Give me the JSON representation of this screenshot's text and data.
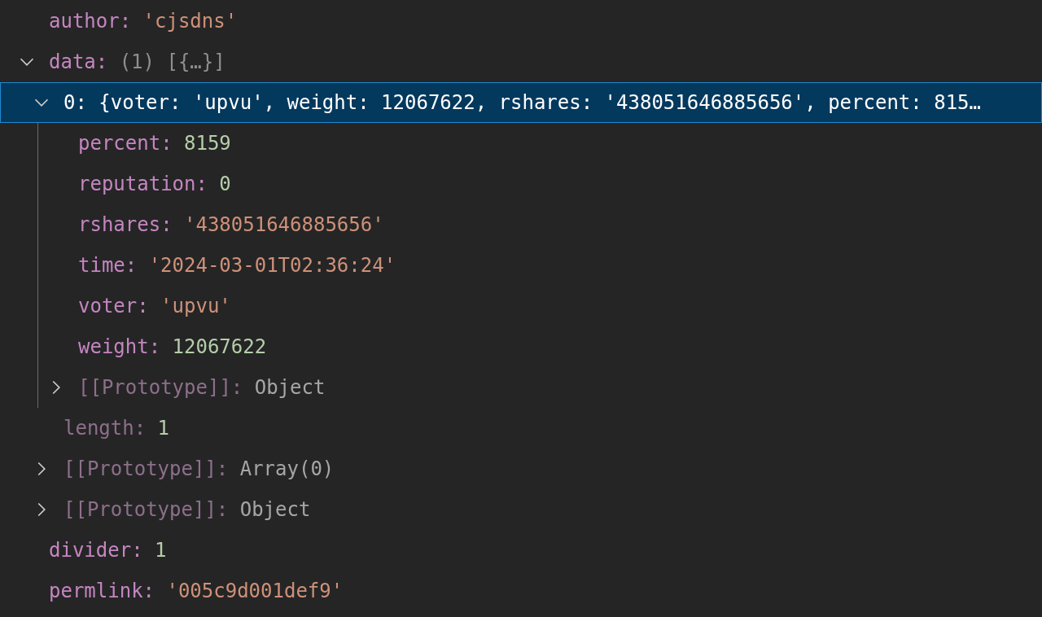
{
  "variables": [
    {
      "name": "author:",
      "value": "'cjsdns'",
      "kind": "string",
      "dimmed": false,
      "selected": false
    },
    {
      "name": "data:",
      "value": "(1) [{…}]",
      "kind": "preview",
      "dimmed": false,
      "selected": false,
      "expanded": true,
      "children": [
        {
          "name": "0:",
          "value": "{voter: 'upvu', weight: 12067622, rshares: '438051646885656', percent: 815…",
          "kind": "preview",
          "dimmed": false,
          "selected": true,
          "expanded": true,
          "children": [
            {
              "name": "percent:",
              "value": "8159",
              "kind": "number",
              "dimmed": false,
              "selected": false
            },
            {
              "name": "reputation:",
              "value": "0",
              "kind": "number",
              "dimmed": false,
              "selected": false
            },
            {
              "name": "rshares:",
              "value": "'438051646885656'",
              "kind": "string",
              "dimmed": false,
              "selected": false
            },
            {
              "name": "time:",
              "value": "'2024-03-01T02:36:24'",
              "kind": "string",
              "dimmed": false,
              "selected": false
            },
            {
              "name": "voter:",
              "value": "'upvu'",
              "kind": "string",
              "dimmed": false,
              "selected": false
            },
            {
              "name": "weight:",
              "value": "12067622",
              "kind": "number",
              "dimmed": false,
              "selected": false
            },
            {
              "name": "[[Prototype]]:",
              "value": "Object",
              "kind": "object",
              "dimmed": true,
              "selected": false,
              "expanded": false
            }
          ]
        },
        {
          "name": "length:",
          "value": "1",
          "kind": "number",
          "dimmed": true,
          "selected": false
        },
        {
          "name": "[[Prototype]]:",
          "value": "Array(0)",
          "kind": "object",
          "dimmed": true,
          "selected": false,
          "expanded": false
        },
        {
          "name": "[[Prototype]]:",
          "value": "Object",
          "kind": "object",
          "dimmed": true,
          "selected": false,
          "expanded": false
        }
      ]
    },
    {
      "name": "divider:",
      "value": "1",
      "kind": "number",
      "dimmed": false,
      "selected": false
    },
    {
      "name": "permlink:",
      "value": "'005c9d001def9'",
      "kind": "string",
      "dimmed": false,
      "selected": false
    }
  ]
}
